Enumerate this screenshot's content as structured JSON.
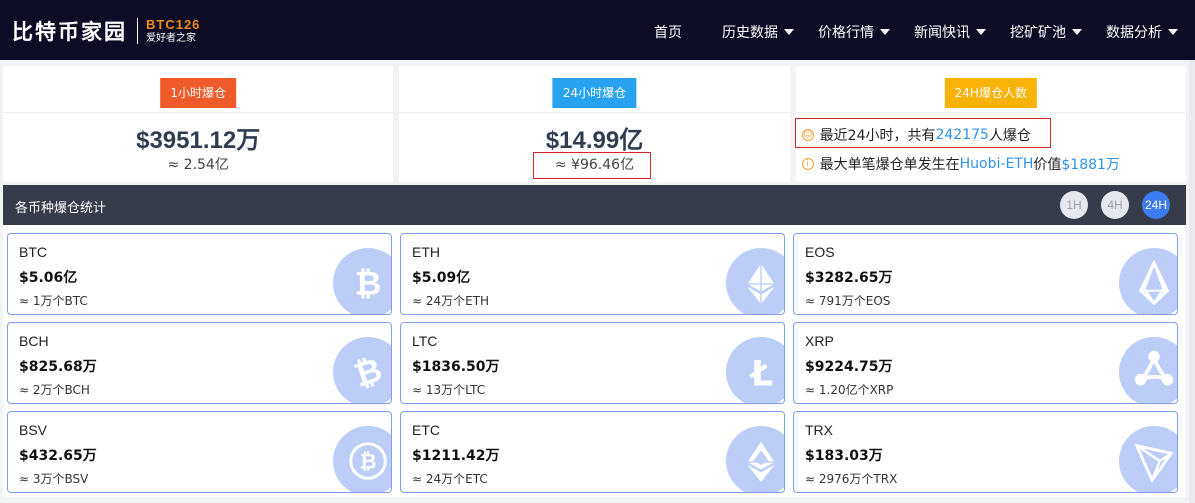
{
  "header": {
    "logo_text": "比特币家园",
    "logo_code": "BTC126",
    "logo_tagline": "爱好者之家",
    "nav": [
      {
        "label": "首页",
        "dropdown": false
      },
      {
        "label": "历史数据",
        "dropdown": true
      },
      {
        "label": "价格行情",
        "dropdown": true
      },
      {
        "label": "新闻快讯",
        "dropdown": true
      },
      {
        "label": "挖矿矿池",
        "dropdown": true
      },
      {
        "label": "数据分析",
        "dropdown": true
      }
    ]
  },
  "summary": {
    "hour": {
      "badge": "1小时爆仓",
      "value": "$3951.12万",
      "sub": "≈ 2.54亿"
    },
    "day": {
      "badge": "24小时爆仓",
      "value": "$14.99亿",
      "sub": "≈ ¥96.46亿"
    },
    "people": {
      "badge": "24H爆仓人数",
      "line1_prefix": "最近24小时，共有",
      "line1_count": "242175",
      "line1_suffix": "人爆仓",
      "line2_prefix": "最大单笔爆仓单发生在",
      "line2_exchange": "Huobi-ETH",
      "line2_mid": "价值",
      "line2_value": "$1881万"
    }
  },
  "stats": {
    "title": "各币种爆仓统计",
    "ranges": [
      "1H",
      "4H",
      "24H"
    ],
    "active_range": "24H"
  },
  "coins": [
    {
      "name": "BTC",
      "value": "$5.06亿",
      "count": "≈ 1万个BTC",
      "icon": "bitcoin-icon"
    },
    {
      "name": "ETH",
      "value": "$5.09亿",
      "count": "≈ 24万个ETH",
      "icon": "ethereum-icon"
    },
    {
      "name": "EOS",
      "value": "$3282.65万",
      "count": "≈ 791万个EOS",
      "icon": "eos-icon"
    },
    {
      "name": "BCH",
      "value": "$825.68万",
      "count": "≈ 2万个BCH",
      "icon": "bitcoin-cash-icon"
    },
    {
      "name": "LTC",
      "value": "$1836.50万",
      "count": "≈ 13万个LTC",
      "icon": "litecoin-icon"
    },
    {
      "name": "XRP",
      "value": "$9224.75万",
      "count": "≈ 1.20亿个XRP",
      "icon": "ripple-icon"
    },
    {
      "name": "BSV",
      "value": "$432.65万",
      "count": "≈ 3万个BSV",
      "icon": "bsv-icon"
    },
    {
      "name": "ETC",
      "value": "$1211.42万",
      "count": "≈ 24万个ETC",
      "icon": "ethereum-classic-icon"
    },
    {
      "name": "TRX",
      "value": "$183.03万",
      "count": "≈ 2976万个TRX",
      "icon": "tron-icon"
    }
  ],
  "colors": {
    "header_bg": "#0d0c24",
    "logo_accent": "#f08a1c",
    "badge_red": "#ef5a2b",
    "badge_blue": "#26a2f0",
    "badge_yellow": "#f9b208",
    "link_blue": "#2f93e8",
    "highlight_border": "#d9262b",
    "stats_bar": "#363c4a",
    "active_range": "#3c7cf0",
    "card_border": "#7f9ff0",
    "coin_logo_bg": "#bccdf8"
  }
}
